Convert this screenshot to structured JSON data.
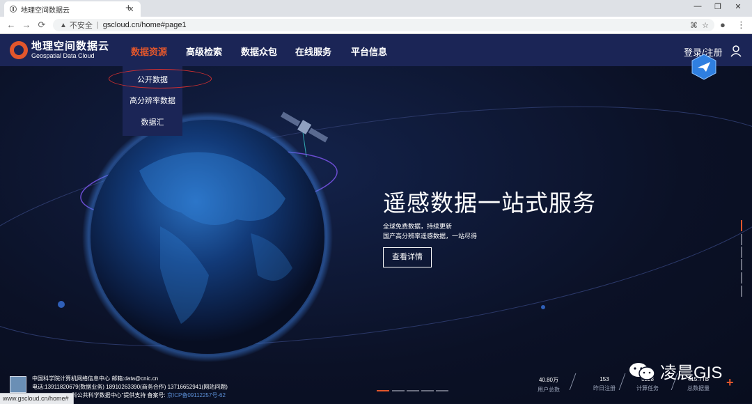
{
  "browser": {
    "tab_title": "地理空间数据云",
    "tab_close": "✕",
    "new_tab": "+",
    "window_controls": [
      "—",
      "❐",
      "✕"
    ],
    "nav": [
      "←",
      "→",
      "⟳"
    ],
    "security_label": "不安全",
    "url": "gscloud.cn/home#page1",
    "right_icons": [
      "⚙",
      "☆",
      "●",
      "⋮"
    ],
    "status_url": "www.gscloud.cn/home#"
  },
  "header": {
    "logo_cn": "地理空间数据云",
    "logo_en": "Geospatial Data Cloud",
    "menu": [
      "数据资源",
      "高级检索",
      "数据众包",
      "在线服务",
      "平台信息"
    ],
    "active_menu": "数据资源",
    "login": "登录/注册"
  },
  "dropdown": {
    "items": [
      "公开数据",
      "高分辨率数据",
      "数据汇"
    ]
  },
  "hero": {
    "title": "遥感数据一站式服务",
    "subtitle1": "全球免费数据，持续更新",
    "subtitle2": "国产高分辨率遥感数据，一站尽得",
    "button": "查看详情"
  },
  "footer": {
    "line1": "中国科学院计算机网络信息中心 邮箱:data@cnic.cn",
    "line2": "电话:13911820679(数据业务) 18910263390(商务合作) 13716652941(网站问题)",
    "line3": "“科公共科学数据中心”提供支持 备案号: ",
    "icp": "京ICP备09112257号-62"
  },
  "stats": [
    {
      "value": "40.80万",
      "label": "用户总数"
    },
    {
      "value": "153",
      "label": "昨日注册"
    },
    {
      "value": "5228",
      "label": "计算任务"
    },
    {
      "value": "415.7TB",
      "label": "总数据量"
    }
  ],
  "watermark": "凌晨GIS",
  "colors": {
    "accent": "#e2562c",
    "header_bg": "#1b2556",
    "hero_bg": "#0b1126",
    "ellipse": "#d83030"
  }
}
